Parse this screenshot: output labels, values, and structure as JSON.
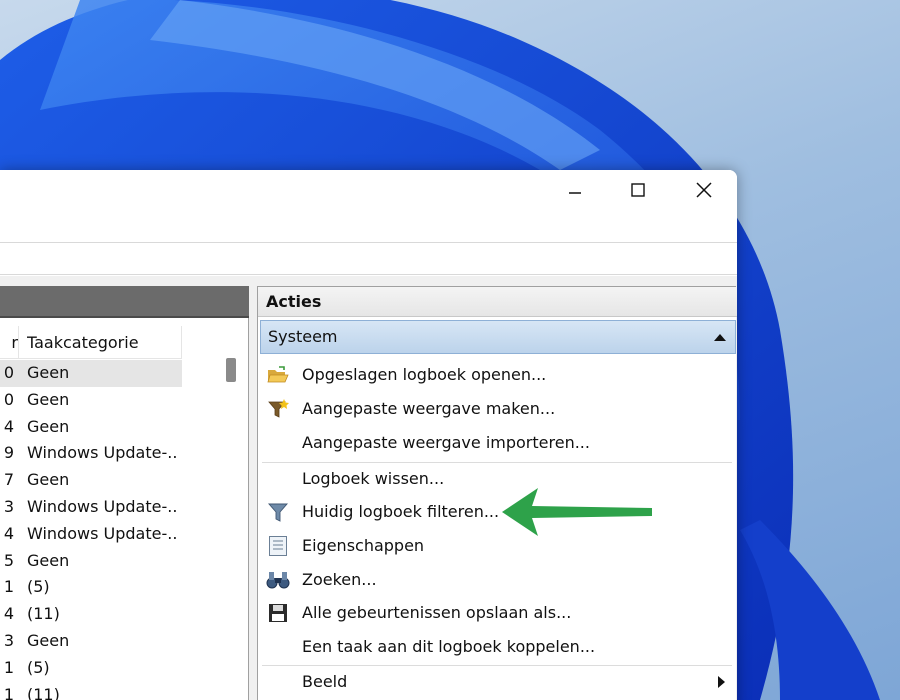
{
  "table": {
    "column_left_header": "r",
    "column_category_header": "Taakcategorie",
    "rows": [
      {
        "left": "0",
        "category": "Geen",
        "selected": true
      },
      {
        "left": "0",
        "category": "Geen"
      },
      {
        "left": "4",
        "category": "Geen"
      },
      {
        "left": "9",
        "category": "Windows Update-..."
      },
      {
        "left": "7",
        "category": "Geen"
      },
      {
        "left": "3",
        "category": "Windows Update-..."
      },
      {
        "left": "4",
        "category": "Windows Update-..."
      },
      {
        "left": "5",
        "category": "Geen"
      },
      {
        "left": "1",
        "category": "(5)"
      },
      {
        "left": "4",
        "category": "(11)"
      },
      {
        "left": "3",
        "category": "Geen"
      },
      {
        "left": "1",
        "category": "(5)"
      },
      {
        "left": "1",
        "category": "(11)"
      }
    ]
  },
  "actions": {
    "title": "Acties",
    "section": "Systeem",
    "items": [
      {
        "label": "Opgeslagen logboek openen...",
        "icon": "folder-open-icon"
      },
      {
        "label": "Aangepaste weergave maken...",
        "icon": "filter-star-icon"
      },
      {
        "label": "Aangepaste weergave importeren...",
        "icon": ""
      },
      {
        "label": "Logboek wissen...",
        "icon": ""
      },
      {
        "label": "Huidig logboek filteren...",
        "icon": "filter-icon"
      },
      {
        "label": "Eigenschappen",
        "icon": "properties-icon"
      },
      {
        "label": "Zoeken...",
        "icon": "binoculars-icon"
      },
      {
        "label": "Alle gebeurtenissen opslaan als...",
        "icon": "save-icon"
      },
      {
        "label": "Een taak aan dit logboek koppelen...",
        "icon": ""
      },
      {
        "label": "Beeld",
        "icon": ""
      }
    ]
  },
  "colors": {
    "annotation_arrow": "#2ea24a",
    "section_header": "#c6daef",
    "window_bg": "#ffffff"
  }
}
